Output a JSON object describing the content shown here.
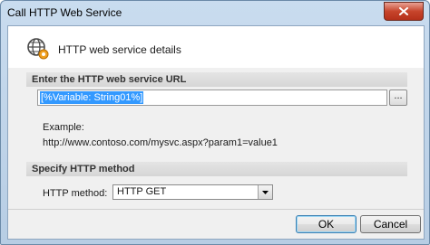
{
  "window": {
    "title": "Call HTTP Web Service",
    "close_icon": "close-icon"
  },
  "header": {
    "icon": "globe-gear-icon",
    "title": "HTTP web service details"
  },
  "url_section": {
    "heading": "Enter the HTTP web service URL",
    "url_value": "[%Variable: String01%]",
    "browse_label": "...",
    "example_label": "Example:",
    "example_url": "http://www.contoso.com/mysvc.aspx?param1=value1"
  },
  "method_section": {
    "heading": "Specify HTTP method",
    "method_label": "HTTP method:",
    "method_value": "HTTP GET",
    "dropdown_icon": "chevron-down-icon"
  },
  "buttons": {
    "ok_label": "OK",
    "cancel_label": "Cancel"
  },
  "colors": {
    "selection": "#3399ff",
    "close_button": "#c7452c",
    "frame": "#b7cde4"
  }
}
